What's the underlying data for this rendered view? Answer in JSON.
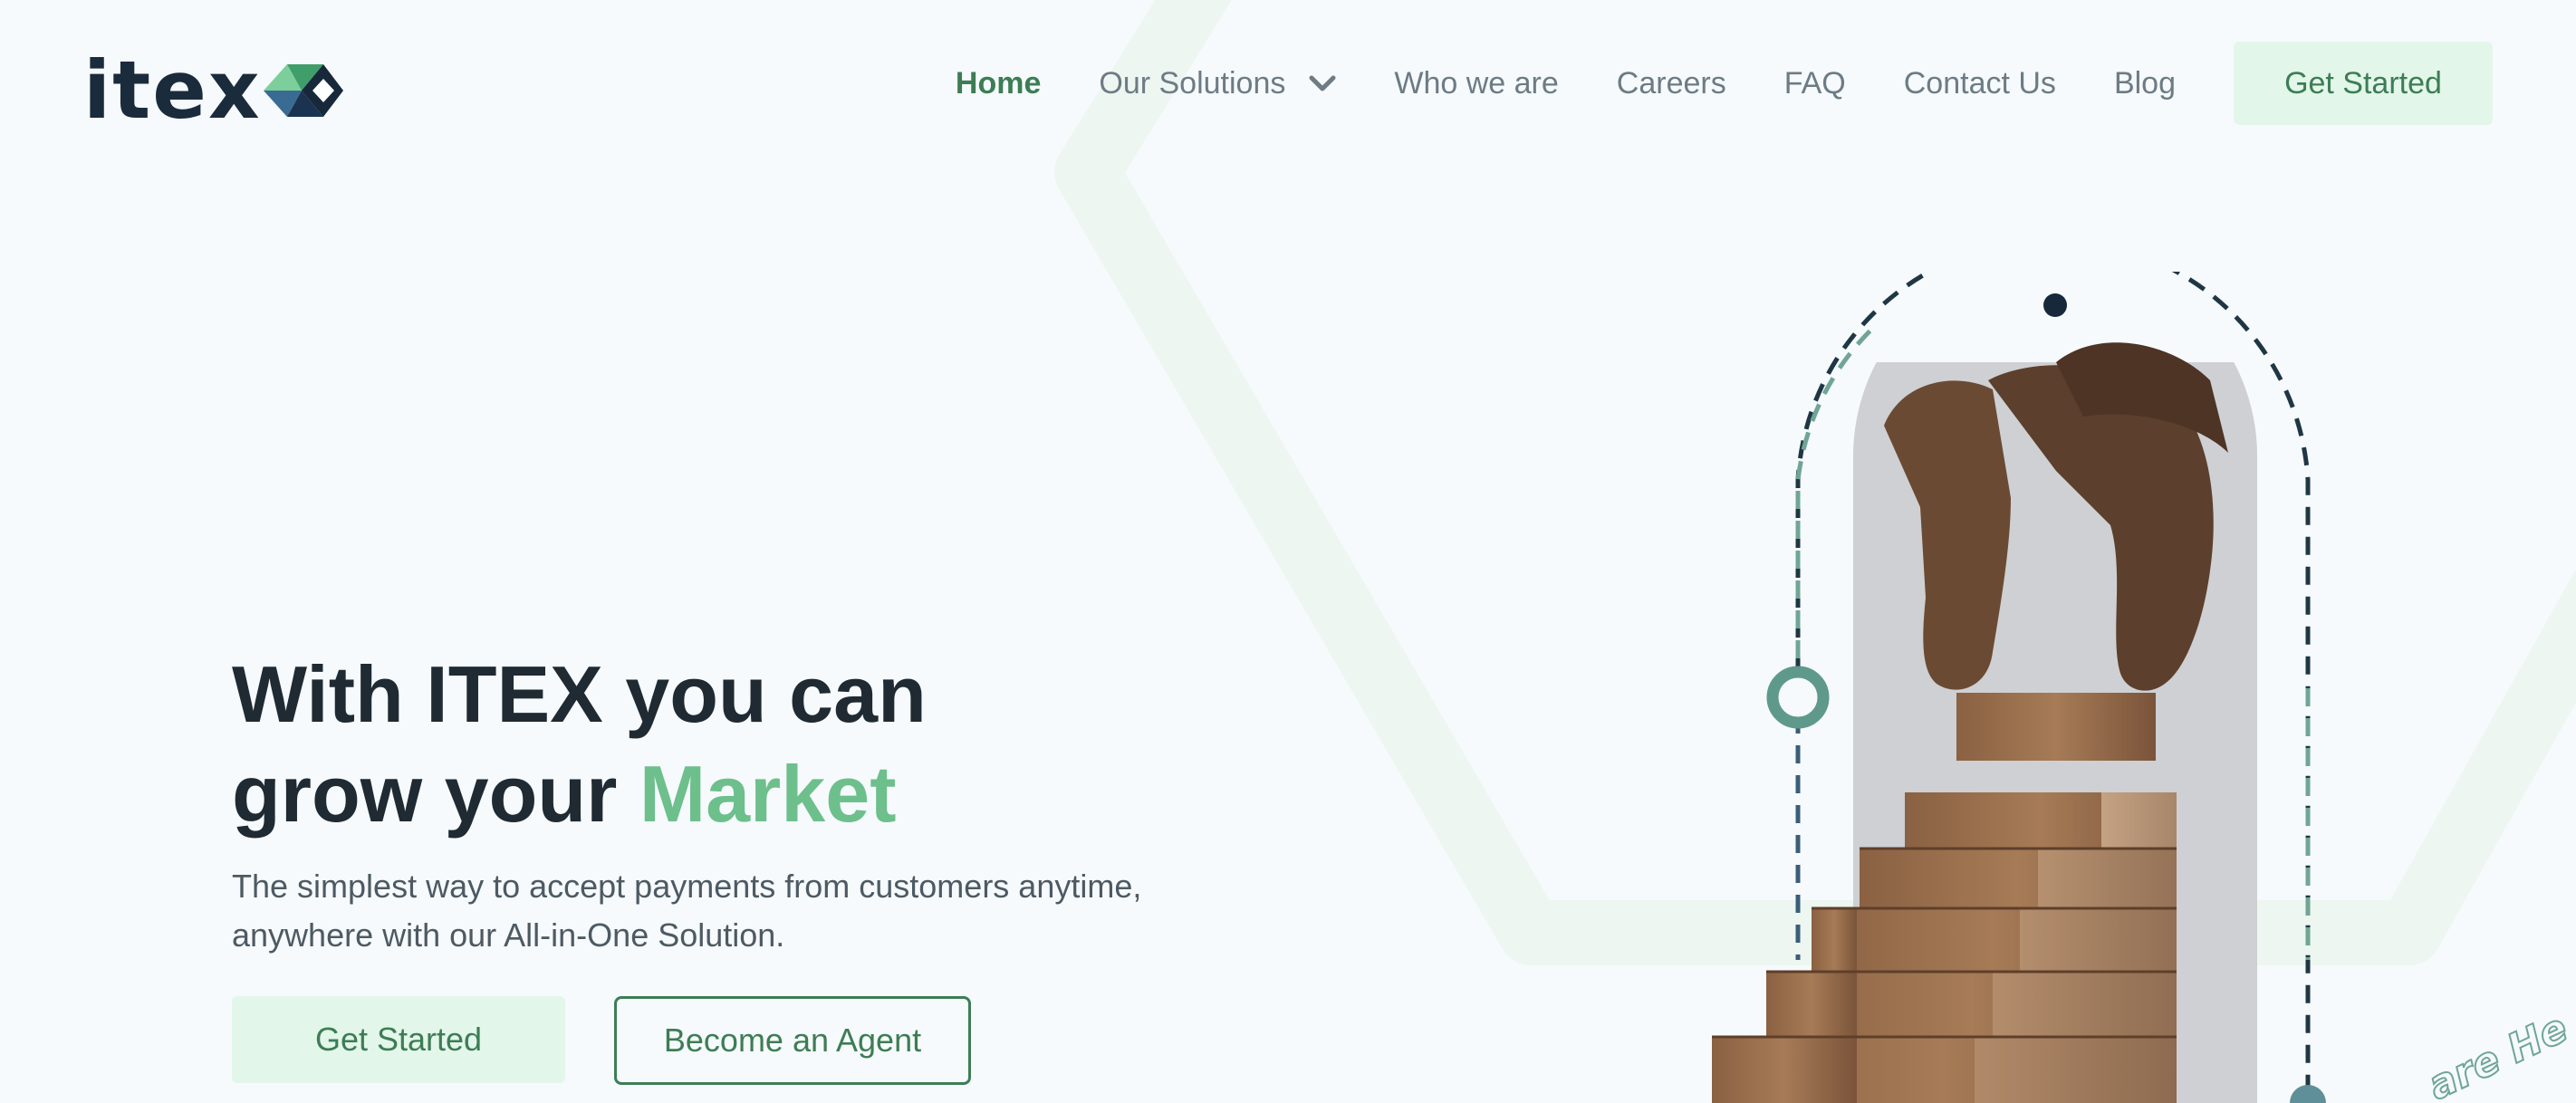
{
  "colors": {
    "accent": "#3d7d55",
    "accent_light": "#6dbf8c",
    "button_bg": "#e3f6ea",
    "background": "#f6fafc",
    "text_dark": "#1f2a33",
    "text_muted": "#6d7b85"
  },
  "brand": {
    "logo_text": "itex",
    "logo_mark_icon": "itex-diamond-logo-icon"
  },
  "nav": {
    "items": [
      {
        "label": "Home",
        "active": true
      },
      {
        "label": "Our Solutions",
        "has_dropdown": true
      },
      {
        "label": "Who we are"
      },
      {
        "label": "Careers"
      },
      {
        "label": "FAQ"
      },
      {
        "label": "Contact Us"
      },
      {
        "label": "Blog"
      }
    ],
    "cta_label": "Get Started"
  },
  "hero": {
    "title_line1": "With ITEX you can",
    "title_line2_prefix": "grow your",
    "title_accent": "Market",
    "subtitle_line1": "The simplest way to accept payments from customers anytime,",
    "subtitle_line2": "anywhere with our All-in-One Solution.",
    "primary_button": "Get Started",
    "secondary_button": "Become an Agent"
  },
  "illustration": {
    "image_subject": "hand-stacking-wooden-blocks-image",
    "curved_text_fragment": "are He"
  }
}
